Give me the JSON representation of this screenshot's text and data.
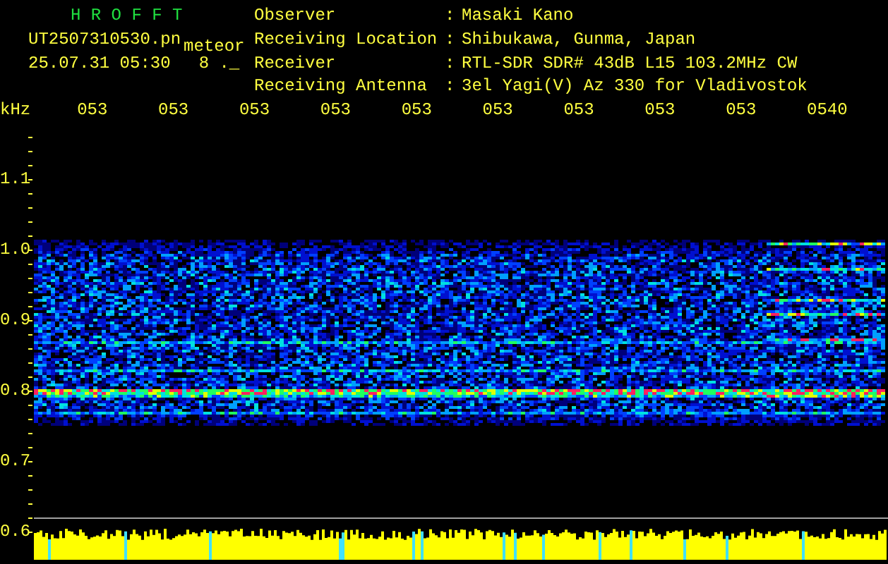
{
  "app": {
    "title": "H R O F F T"
  },
  "file": {
    "name": "UT2507310530.pn",
    "tag": "meteor",
    "datetime": "25.07.31 05:30",
    "column_4": "8 ._"
  },
  "info": [
    {
      "label": "Observer",
      "separator": ":",
      "value": "Masaki Kano"
    },
    {
      "label": "Receiving Location",
      "separator": ":",
      "value": "Shibukawa, Gunma, Japan"
    },
    {
      "label": "Receiver",
      "separator": ":",
      "value": "RTL-SDR SDR# 43dB L15 103.2MHz CW"
    },
    {
      "label": "Receiving Antenna",
      "separator": ":",
      "value": "3el Yagi(V) Az 330 for Vladivostok"
    }
  ],
  "time_axis": {
    "unit": "kHz",
    "labels": [
      "053",
      "053",
      "053",
      "053",
      "053",
      "053",
      "053",
      "053",
      "053",
      "0540"
    ]
  },
  "freq_axis": {
    "labels": [
      "1.1",
      "1.0",
      "0.9",
      "0.8",
      "0.7",
      "0.6"
    ]
  }
}
